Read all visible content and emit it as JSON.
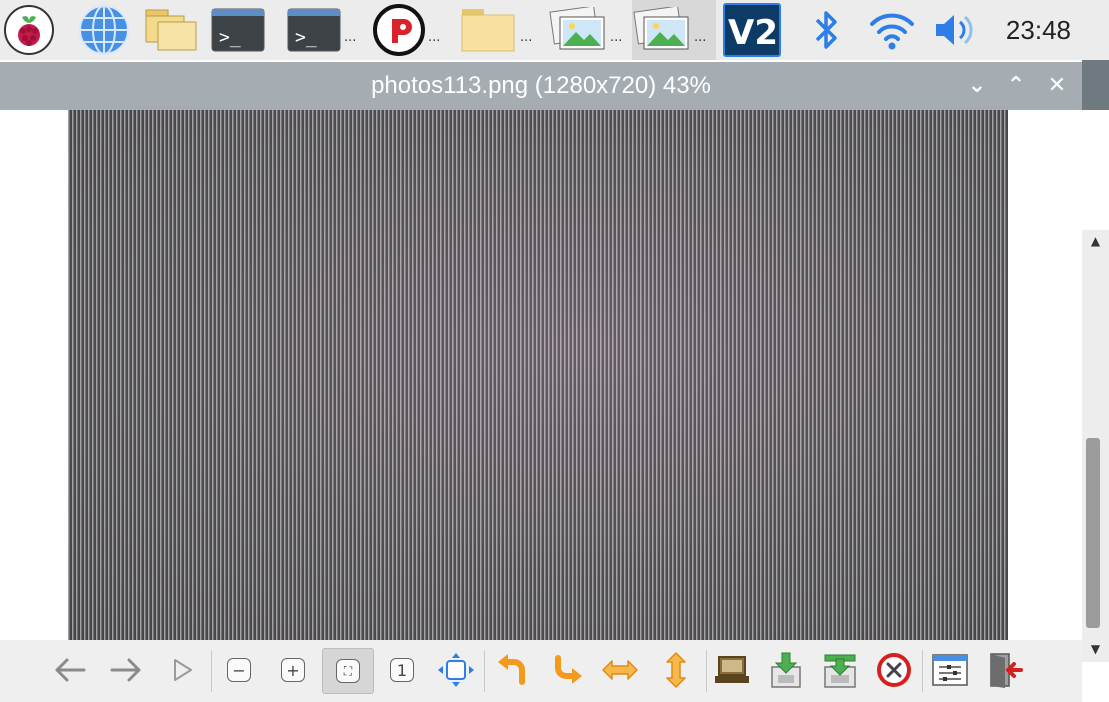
{
  "taskbar": {
    "items": [
      {
        "name": "raspberry-menu-icon"
      },
      {
        "name": "web-browser-icon"
      },
      {
        "name": "file-manager-icon"
      },
      {
        "name": "terminal-icon"
      },
      {
        "name": "terminal-window-button",
        "dots": "..."
      },
      {
        "name": "app-window-button",
        "dots": "..."
      },
      {
        "name": "folder-window-button",
        "dots": "..."
      },
      {
        "name": "image-viewer-window-button",
        "dots": "..."
      },
      {
        "name": "image-viewer-window-button-active",
        "dots": "..."
      },
      {
        "name": "vnc-icon",
        "label": "V2"
      },
      {
        "name": "bluetooth-icon"
      },
      {
        "name": "wifi-icon"
      },
      {
        "name": "volume-icon"
      }
    ],
    "clock": "23:48"
  },
  "window": {
    "title": "photos113.png (1280x720) 43%",
    "buttons": {
      "minimize": "⌄",
      "maximize": "⌃",
      "close": "✕"
    }
  },
  "toolbar": {
    "zoom_original_label": "1"
  },
  "colors": {
    "taskbar_bg": "#ececec",
    "titlebar_bg": "#a5adb2",
    "toolbar_bg": "#efefef",
    "accent_blue": "#2d7ee6",
    "rotate_orange": "#f39a1c",
    "close_red": "#d62020"
  }
}
